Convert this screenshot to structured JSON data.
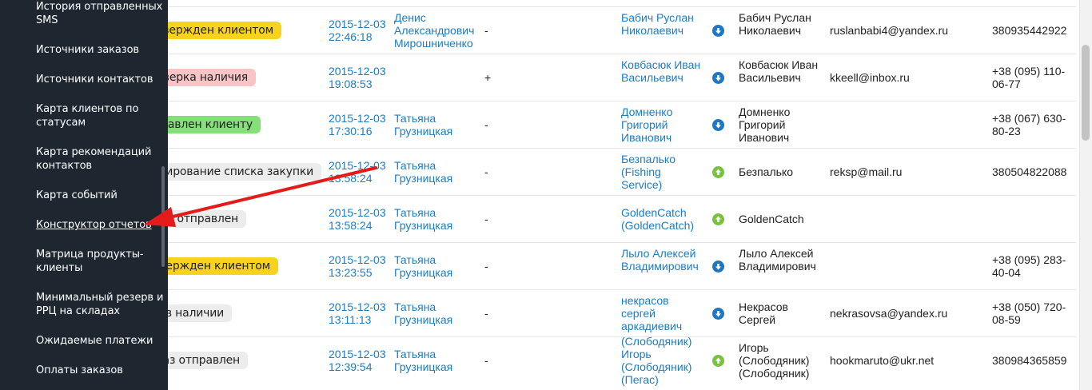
{
  "sidebar": {
    "items": [
      {
        "label": "История отправленных SMS"
      },
      {
        "label": "Источники заказов"
      },
      {
        "label": "Источники контактов"
      },
      {
        "label": "Карта клиентов по статусам"
      },
      {
        "label": "Карта рекомендаций контактов"
      },
      {
        "label": "Карта событий"
      },
      {
        "label": "Конструктор отчетов"
      },
      {
        "label": "Матрица продукты-клиенты"
      },
      {
        "label": "Минимальный резерв и РРЦ на складах"
      },
      {
        "label": "Ожидаемые платежи"
      },
      {
        "label": "Оплаты заказов"
      }
    ],
    "active_item": "Конструктор отчетов"
  },
  "orders": {
    "rows": [
      {
        "status": "Подтвержден клиентом",
        "status_color": "#f7d21e",
        "date": "2015-12-03",
        "time": "22:46:18",
        "manager": "Денис Александрович Мирошниченко",
        "sign": "-",
        "contact": "Бабич Руслан Николаевич",
        "direction": "down",
        "client": "Бабич Руслан Николаевич",
        "email": "ruslanbabi4@yandex.ru",
        "phone": "380935442922"
      },
      {
        "status": "Проверка наличия",
        "status_color": "#f8c4c6",
        "date": "2015-12-03",
        "time": "19:08:53",
        "manager": "",
        "sign": "+",
        "contact": "Ковбасюк Иван Васильевич",
        "direction": "down",
        "client": "Ковбасюк Иван Васильевич",
        "email": "kkeell@inbox.ru",
        "phone": "+38 (095) 110-06-77"
      },
      {
        "status": "Отправлен клиенту",
        "status_color": "#86e07a",
        "date": "2015-12-03",
        "time": "17:30:16",
        "manager": "Татьяна Грузницкая",
        "sign": "-",
        "contact": "Домненко Григорий Иванович",
        "direction": "down",
        "client": "Домненко Григорий Иванович",
        "email": "",
        "phone": "+38 (067) 630-80-23"
      },
      {
        "status": "Формирование списка закупки",
        "status_color": "#ececec",
        "date": "2015-12-03",
        "time": "13:58:24",
        "manager": "Татьяна Грузницкая",
        "sign": "-",
        "contact": "Безпалько (Fishing Service)",
        "direction": "up",
        "client": "Безпалько",
        "email": "reksp@mail.ru",
        "phone": "380504822088"
      },
      {
        "status": "Заказ отправлен",
        "status_color": "#ececec",
        "date": "2015-12-03",
        "time": "13:58:24",
        "manager": "Татьяна Грузницкая",
        "sign": "-",
        "contact": "GoldenCatch (GoldenCatch)",
        "direction": "up",
        "client": "GoldenCatch",
        "email": "",
        "phone": ""
      },
      {
        "status": "Подтвержден клиентом",
        "status_color": "#f7d21e",
        "date": "2015-12-03",
        "time": "13:23:55",
        "manager": "Татьяна Грузницкая",
        "sign": "-",
        "contact": "Лыло Алексей Владимирович",
        "direction": "down",
        "client": "Лыло Алексей Владимирович",
        "email": "",
        "phone": "+38 (095) 283-40-04"
      },
      {
        "status": "Нет в наличии",
        "status_color": "#ececec",
        "date": "2015-12-03",
        "time": "13:11:13",
        "manager": "Татьяна Грузницкая",
        "sign": "-",
        "contact": "некрасов сергей аркадиевич",
        "direction": "down",
        "client": "Некрасов Сергей",
        "email": "nekrasovsa@yandex.ru",
        "phone": "+38 (050) 720-08-59"
      },
      {
        "status": "Заказ отправлен",
        "status_color": "#ececec",
        "date": "2015-12-03",
        "time": "12:39:54",
        "manager": "Татьяна Грузницкая",
        "sign": "-",
        "contact": "(Слободяник) Игорь (Слободяник) (Пегас)",
        "direction": "up",
        "client": "Игорь (Слободяник) (Слободяник)",
        "email": "hookmaruto@ukr.net",
        "phone": "380984365859"
      }
    ]
  },
  "icons": {
    "direction_down": "arrow-down-circle-icon",
    "direction_up": "arrow-up-circle-icon"
  },
  "colors": {
    "sidebar_bg": "#1e2730",
    "link": "#1c7cc4",
    "annotation_arrow": "#e31b1b"
  }
}
